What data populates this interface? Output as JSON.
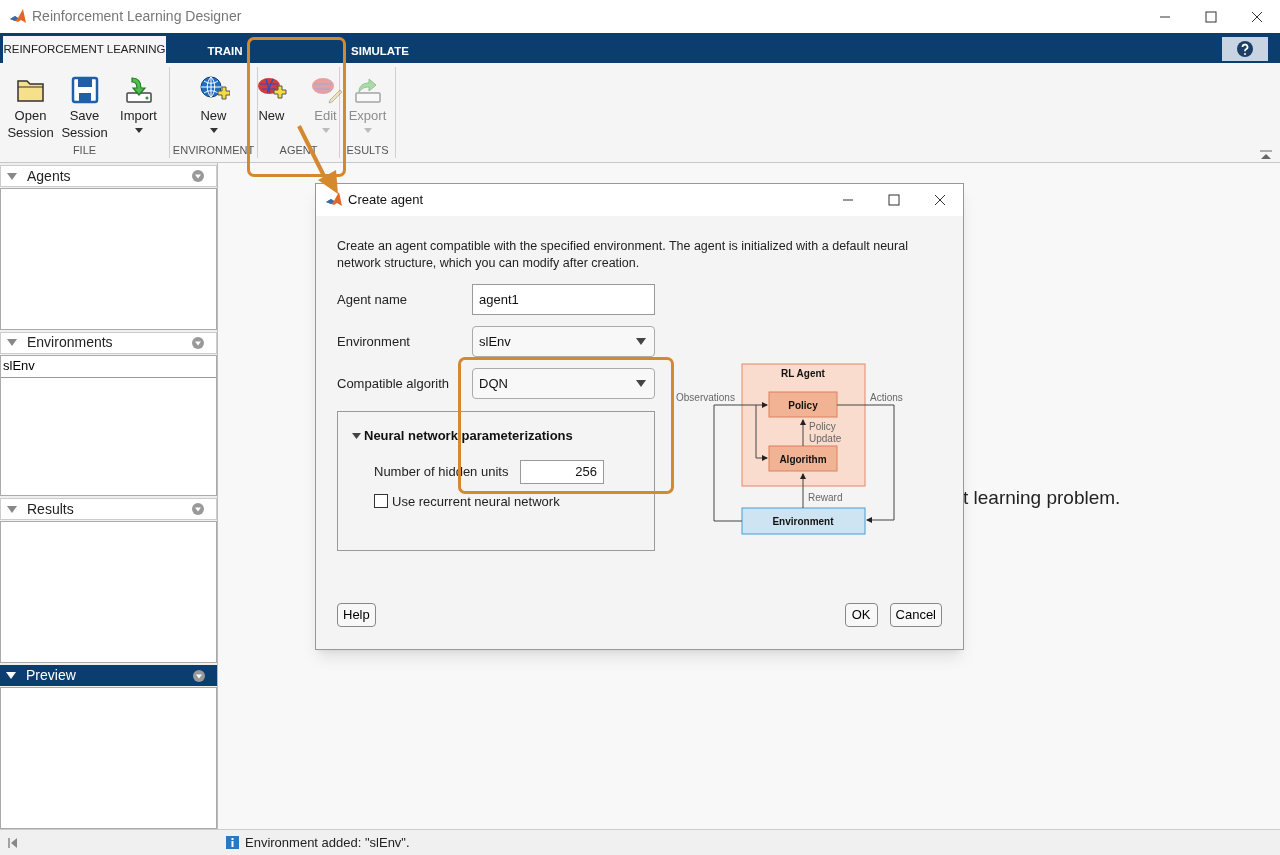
{
  "window": {
    "title": "Reinforcement Learning Designer"
  },
  "tabs": [
    {
      "label": "REINFORCEMENT LEARNING",
      "selected": true
    },
    {
      "label": "TRAIN",
      "selected": false
    },
    {
      "label": "SIMULATE",
      "selected": false
    }
  ],
  "toolstrip": [
    {
      "section": "FILE",
      "buttons": [
        {
          "label": "Open Session",
          "disabled": false,
          "dropdown": false
        },
        {
          "label": "Save Session",
          "disabled": false,
          "dropdown": false
        },
        {
          "label": "Import",
          "disabled": false,
          "dropdown": true
        }
      ]
    },
    {
      "section": "ENVIRONMENT",
      "buttons": [
        {
          "label": "New",
          "disabled": false,
          "dropdown": true
        }
      ]
    },
    {
      "section": "AGENT",
      "buttons": [
        {
          "label": "New",
          "disabled": false,
          "dropdown": false
        },
        {
          "label": "Edit",
          "disabled": true,
          "dropdown": true
        }
      ]
    },
    {
      "section": "ESULTS",
      "buttons": [
        {
          "label": "Export",
          "disabled": true,
          "dropdown": true
        }
      ]
    }
  ],
  "panels": [
    {
      "title": "Agents",
      "selected": false
    },
    {
      "title": "Environments",
      "selected": false,
      "items": [
        "slEnv"
      ]
    },
    {
      "title": "Results",
      "selected": false
    },
    {
      "title": "Preview",
      "selected": true
    }
  ],
  "main_text": "t learning problem.",
  "status_bar": "Environment added: \"slEnv\".",
  "dialog": {
    "title": "Create agent",
    "description": "Create an agent compatible with the specified environment. The agent is initialized with a default neural network structure, which you can modify after creation.",
    "fields": [
      {
        "label": "Agent name",
        "kind": "text",
        "value": "agent1"
      },
      {
        "label": "Environment",
        "kind": "dropdown",
        "value": "slEnv"
      },
      {
        "label": "Compatible algorith",
        "kind": "dropdown",
        "value": "DQN"
      }
    ],
    "section": {
      "title": "Neural network parameterizations",
      "expanded": true,
      "hidden_units": {
        "label": "Number of hidden units",
        "value": "256"
      },
      "checkbox": {
        "label": "Use recurrent neural network",
        "checked": false
      }
    },
    "diagram": {
      "agent": "RL Agent",
      "policy": "Policy",
      "algorithm": "Algorithm",
      "environment": "Environment",
      "observations": "Observations",
      "actions": "Actions",
      "update": [
        "Policy",
        "Update"
      ],
      "reward": "Reward"
    },
    "buttons": {
      "help": "Help",
      "ok": "OK",
      "cancel": "Cancel"
    }
  }
}
